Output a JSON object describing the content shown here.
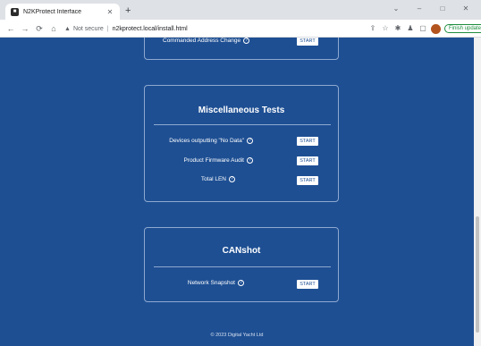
{
  "browser": {
    "tab_title": "N2KProtect Interface",
    "tab_favicon": "🔒",
    "url_insecure_label": "Not secure",
    "url": "n2kprotect.local/install.html",
    "finish_update": "Finish update"
  },
  "sections": {
    "address": {
      "label": "Commanded Address Change",
      "button": "START"
    },
    "misc": {
      "title": "Miscellaneous Tests",
      "rows": [
        {
          "label": "Devices outputting \"No Data\"",
          "button": "START"
        },
        {
          "label": "Product Firmware Audit",
          "button": "START"
        },
        {
          "label": "Total LEN",
          "button": "START"
        }
      ]
    },
    "canshot": {
      "title": "CANshot",
      "rows": [
        {
          "label": "Network Snapshot",
          "button": "START"
        }
      ]
    }
  },
  "footer": "© 2023 Digital Yacht Ltd",
  "colors": {
    "page_bg": "#1e4f93",
    "card_border": "#8fa9cf",
    "button_bg": "#ffffff"
  }
}
